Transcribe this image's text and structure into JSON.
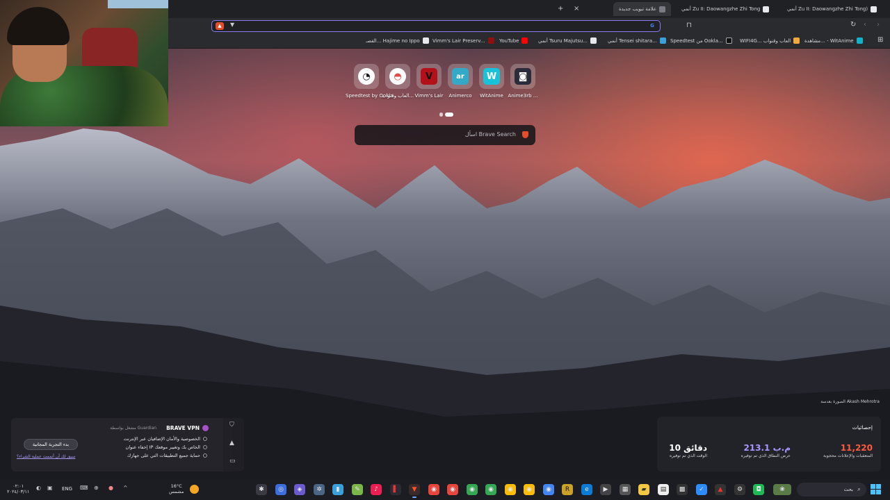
{
  "browser": {
    "tabs": [
      {
        "title": "أنمي Zu II: Daowangzhe Zhi Tong)",
        "active": false
      },
      {
        "title": "أنمي Zu II: Daowangzhe Zhi Tong",
        "active": false
      },
      {
        "title": "علامة تبويب جديدة",
        "active": true
      }
    ],
    "new_tab_symbol": "+",
    "close_symbol": "×",
    "address": {
      "value": "",
      "placeholder": ""
    },
    "bookmarks": [
      {
        "label": "مشاهدة... - WitAnime",
        "color": "#10b3c9"
      },
      {
        "label": "WIFI4G... العاب وقنواب",
        "color": "#f2a93b"
      },
      {
        "label": "Speedtest من Ookla...",
        "color": "#111111"
      },
      {
        "label": "أنمي Tensei shitara...",
        "color": "#3aa0d9"
      },
      {
        "label": "أنمي Tsuru Majutsu...",
        "color": "#2d2d38"
      },
      {
        "label": "YouTube",
        "color": "#ff0000"
      },
      {
        "label": "Vimm's Lair Preserv...",
        "color": "#8e1010"
      },
      {
        "label": "القصـ... Hajime no Ippo",
        "color": "#2d2d38"
      }
    ]
  },
  "top_sites": [
    {
      "label": "Speedtest by Ookla",
      "glyph": "◔",
      "bg": "#ffffff",
      "fg": "#141416"
    },
    {
      "label": "العاب وقنواب...",
      "glyph": "◓",
      "bg": "#ffffff",
      "fg": "#e24a4a"
    },
    {
      "label": "Vimm's Lair",
      "glyph": "V",
      "bg": "#b3101a",
      "fg": "#111"
    },
    {
      "label": "Animerco",
      "glyph": "ar",
      "bg": "#33a9c7",
      "fg": "#fff"
    },
    {
      "label": "WitAnime",
      "glyph": "W",
      "bg": "#18c2d8",
      "fg": "#fff"
    },
    {
      "label": "Anime3rb ...",
      "glyph": "◙",
      "bg": "#2b2b3a",
      "fg": "#fff"
    }
  ],
  "search": {
    "text": "اسأل Brave Search"
  },
  "photo_credit": "الصورة بعدسة Akash Mehrotra",
  "vpn": {
    "title": "BRAVE VPN",
    "powered": "مشغل بواسطة Guardian",
    "features": [
      "الخصوصية والأمان الإضافيان عبر الإنترنت",
      "إخفاء عنوان IP الخاص بك وتغيير موقعك",
      "حماية جميع التطبيقات التي على جهازك"
    ],
    "cta": "بدء التجربة المجانية",
    "link": "سبق لك أن أتممت عملية الشراء؟"
  },
  "stats": {
    "title": "إحصائيات",
    "items": [
      {
        "value": "11,220",
        "label": "المتعقبات والإعلانات محجوبة",
        "color": "#ff5a3c"
      },
      {
        "value": "213.1 م.ب",
        "label": "عرض النطاق الذي تم توفيره",
        "color": "#a996ff"
      },
      {
        "value": "10 دقائق",
        "label": "الوقت الذي تم توفيره",
        "color": "#ffffff"
      }
    ]
  },
  "taskbar": {
    "clock_time": "٠٢:٠١",
    "clock_date": "٢٠٢٤/٠٣/١١",
    "lang": "ENG",
    "weather_temp": "16°C",
    "weather_desc": "مشمس",
    "search_label": "بحث"
  }
}
